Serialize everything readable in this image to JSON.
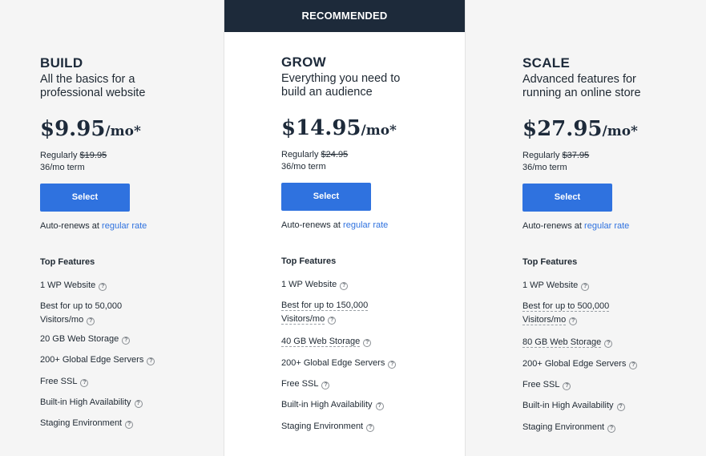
{
  "recommended_label": "RECOMMENDED",
  "plans": [
    {
      "name": "BUILD",
      "desc1": "All the basics for a",
      "desc2": "professional website",
      "price": "$9.95",
      "per": "/mo*",
      "regularly": "Regularly",
      "old_price": "$19.95",
      "term": "36/mo term",
      "select": "Select",
      "renew_text": "Auto-renews at",
      "renew_link": "regular rate",
      "top_features": "Top Features",
      "features": [
        {
          "l1": "1 WP Website"
        },
        {
          "l1": "Best for up to 50,000",
          "l2": "Visitors/mo"
        },
        {
          "l1": "20 GB Web Storage"
        },
        {
          "l1": "200+ Global Edge Servers"
        },
        {
          "l1": "Free SSL"
        },
        {
          "l1": "Built-in High Availability"
        },
        {
          "l1": "Staging Environment"
        }
      ]
    },
    {
      "name": "GROW",
      "desc1": "Everything you need to",
      "desc2": "build an audience",
      "price": "$14.95",
      "per": "/mo*",
      "regularly": "Regularly",
      "old_price": "$24.95",
      "term": "36/mo term",
      "select": "Select",
      "renew_text": "Auto-renews at",
      "renew_link": "regular rate",
      "top_features": "Top Features",
      "features": [
        {
          "l1": "1 WP Website"
        },
        {
          "l1": "Best for up to 150,000",
          "l2": "Visitors/mo"
        },
        {
          "l1": "40 GB Web Storage"
        },
        {
          "l1": "200+ Global Edge Servers"
        },
        {
          "l1": "Free SSL"
        },
        {
          "l1": "Built-in High Availability"
        },
        {
          "l1": "Staging Environment"
        }
      ]
    },
    {
      "name": "SCALE",
      "desc1": "Advanced features for",
      "desc2": "running an online store",
      "price": "$27.95",
      "per": "/mo*",
      "regularly": "Regularly",
      "old_price": "$37.95",
      "term": "36/mo term",
      "select": "Select",
      "renew_text": "Auto-renews at",
      "renew_link": "regular rate",
      "top_features": "Top Features",
      "features": [
        {
          "l1": "1 WP Website"
        },
        {
          "l1": "Best for up to 500,000",
          "l2": "Visitors/mo"
        },
        {
          "l1": "80 GB Web Storage"
        },
        {
          "l1": "200+ Global Edge Servers"
        },
        {
          "l1": "Free SSL"
        },
        {
          "l1": "Built-in High Availability"
        },
        {
          "l1": "Staging Environment"
        }
      ]
    }
  ],
  "help_icon": "question-circle-icon",
  "colors": {
    "accent": "#2f72df",
    "banner": "#1d2a3a"
  }
}
